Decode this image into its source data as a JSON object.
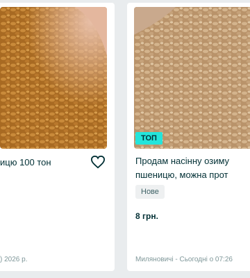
{
  "listings": [
    {
      "title": "ицю 100 тон",
      "meta": ") 2026 р.",
      "favorite_icon": "heart-icon"
    },
    {
      "badge": "ТОП",
      "title_line1": "Продам насінну озиму",
      "title_line2": "пшеницю, можна прот",
      "tag": "Нове",
      "price": "8 грн.",
      "meta": "Миляновичі - Сьогодні о 07:26"
    }
  ],
  "colors": {
    "badge_top": "#23e5db",
    "text_primary": "#002f34",
    "text_muted": "#7f9799"
  }
}
